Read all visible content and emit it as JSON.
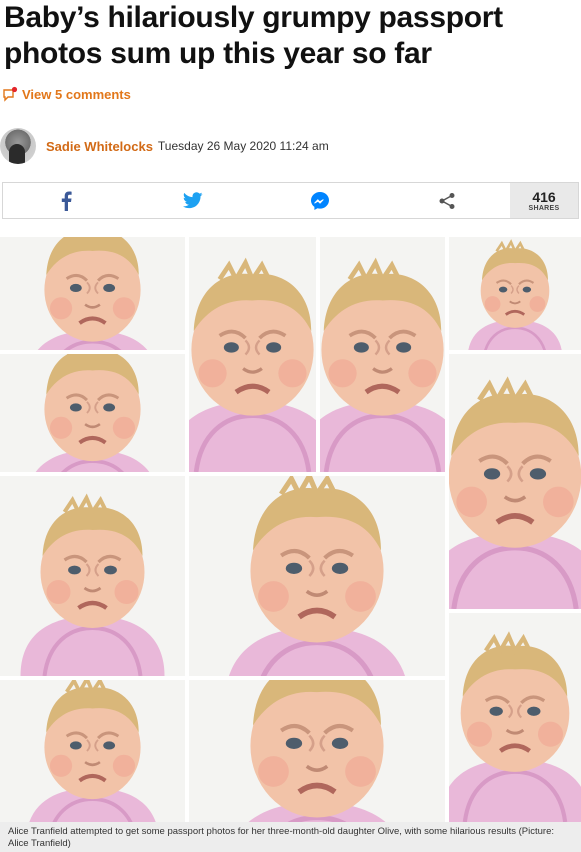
{
  "article": {
    "headline": "Baby’s hilariously grumpy passport photos sum up this year so far",
    "comments_label": "View 5 comments",
    "author": "Sadie Whitelocks",
    "date": "Tuesday 26 May 2020 11:24 am"
  },
  "share_bar": {
    "buttons": [
      {
        "name": "facebook",
        "icon": "facebook-icon",
        "color": "#3b5998"
      },
      {
        "name": "twitter",
        "icon": "twitter-icon",
        "color": "#1da1f2"
      },
      {
        "name": "messenger",
        "icon": "messenger-icon",
        "color": "#0084ff"
      },
      {
        "name": "share",
        "icon": "share-icon",
        "color": "#555555"
      }
    ],
    "share_count": "416",
    "share_count_label": "SHARES"
  },
  "colors": {
    "accent_orange": "#e2771a",
    "author_orange": "#d26a16",
    "caption_bg": "#ededed"
  },
  "image_caption": "Alice Tranfield attempted to get some passport photos for her three-month-old daughter Olive, with some hilarious results (Picture: Alice Tranfield)"
}
